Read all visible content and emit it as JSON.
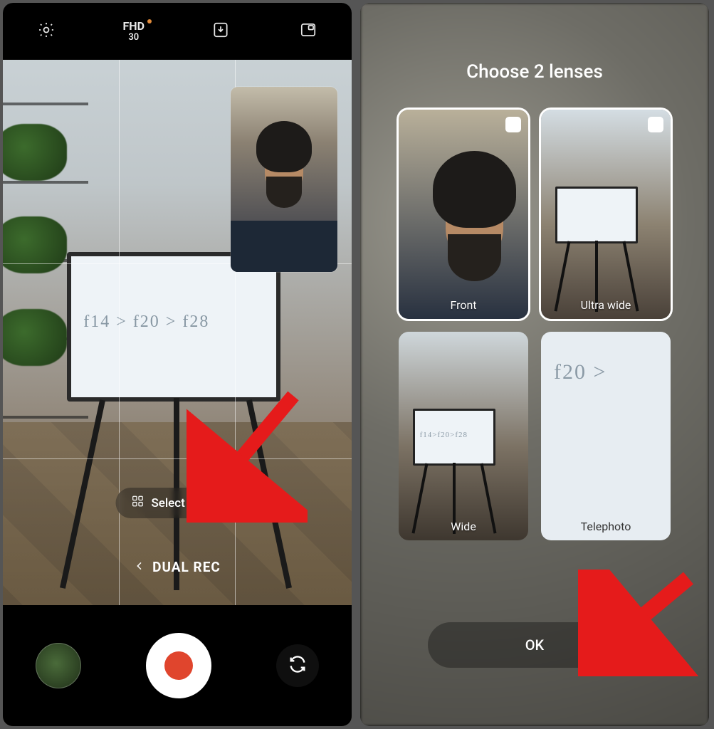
{
  "left": {
    "topbar": {
      "resolution": "FHD",
      "fps": "30"
    },
    "whiteboard_text": "f14 > f20 > f28",
    "select_lenses_label": "Select lenses",
    "mode_label": "DUAL REC"
  },
  "right": {
    "title": "Choose 2 lenses",
    "lenses": [
      {
        "label": "Front",
        "selected": true
      },
      {
        "label": "Ultra wide",
        "selected": true
      },
      {
        "label": "Wide",
        "selected": false
      },
      {
        "label": "Telephoto",
        "selected": false
      }
    ],
    "wide_whiteboard_text": "f14>f20>f28",
    "tele_whiteboard_text": "f20 >",
    "ok_label": "OK"
  }
}
